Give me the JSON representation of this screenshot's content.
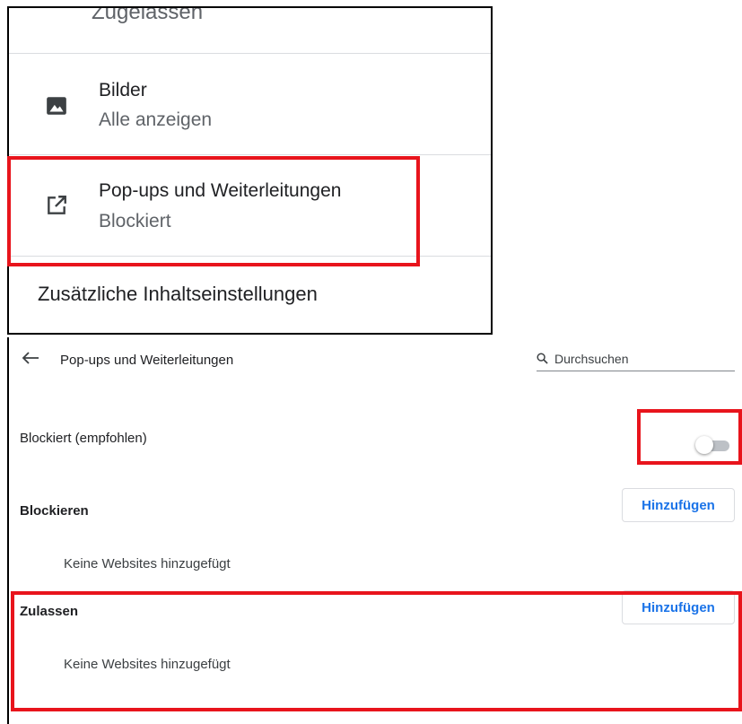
{
  "site_settings_list": {
    "partial_row_label": "Zugelassen",
    "images": {
      "title": "Bilder",
      "status": "Alle anzeigen",
      "icon": "image-icon"
    },
    "popups": {
      "title": "Pop-ups und Weiterleitungen",
      "status": "Blockiert",
      "icon": "open-in-new-icon"
    },
    "additional_settings": "Zusätzliche Inhaltseinstellungen"
  },
  "popup_settings": {
    "header": {
      "title": "Pop-ups und Weiterleitungen",
      "back_icon": "arrow-back-icon",
      "search_placeholder": "Durchsuchen"
    },
    "toggle": {
      "label": "Blockiert (empfohlen)",
      "enabled": false
    },
    "block_section": {
      "heading": "Blockieren",
      "add_label": "Hinzufügen",
      "empty_text": "Keine Websites hinzugefügt"
    },
    "allow_section": {
      "heading": "Zulassen",
      "add_label": "Hinzufügen",
      "empty_text": "Keine Websites hinzugefügt"
    }
  },
  "colors": {
    "highlight": "#e8141c",
    "accent": "#1a73e8",
    "text_primary": "#202124",
    "text_secondary": "#5f6368"
  }
}
